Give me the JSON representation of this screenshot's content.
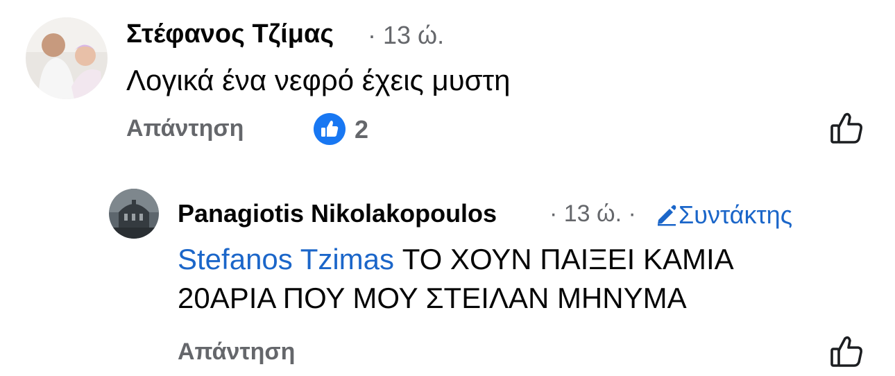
{
  "comment": {
    "author": "Στέφανος Τζίμας",
    "time": "· 13 ώ.",
    "text": "Λογικά  ένα νεφρό έχεις μυστη",
    "reply_label": "Απάντηση",
    "reaction_count": "2",
    "reaction_icon": "like-badge-icon",
    "like_icon": "thumbs-up-outline-icon"
  },
  "reply": {
    "author": "Panagiotis Nikolakopoulos",
    "time": "· 13 ώ. ·",
    "role_icon": "pen-icon",
    "role": "Συντάκτης",
    "mention": "Stefanos Tzimas",
    "text_line1": " ΤΟ ΧΟΥΝ  ΠΑΙΞΕΙ ΚΑΜΙΑ",
    "text_line2": "20ΑΡΙΑ  ΠΟΥ ΜΟΥ ΣΤΕΙΛΑΝ ΜΗΝΥΜΑ",
    "reply_label": "Απάντηση",
    "like_icon": "thumbs-up-outline-icon"
  },
  "colors": {
    "link_blue": "#1b66c9",
    "secondary_text": "#65676b",
    "primary_text": "#050505",
    "like_badge": "#1877f2"
  }
}
